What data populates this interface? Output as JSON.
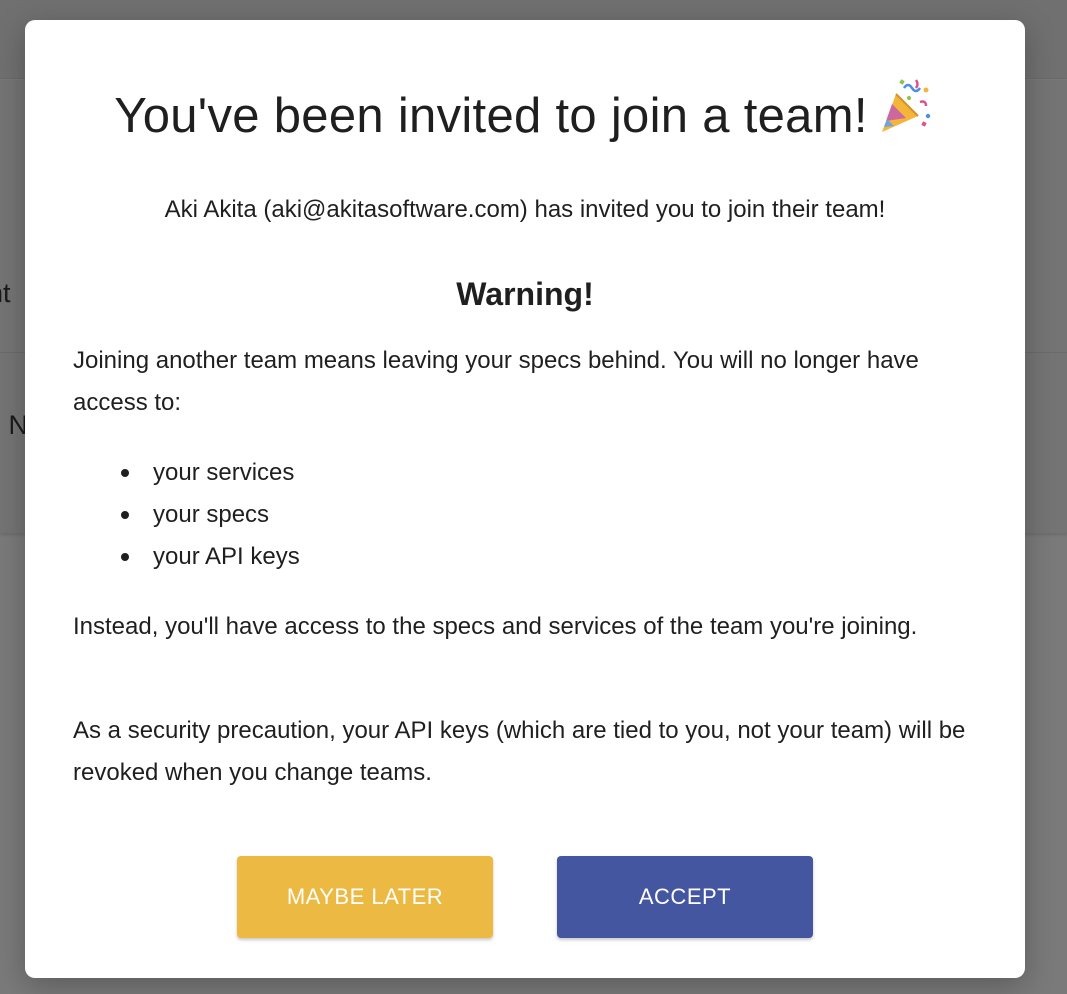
{
  "background": {
    "partial_text_1": "nt",
    "partial_text_2": "d N"
  },
  "modal": {
    "title": "You've been invited to join a team!",
    "title_icon": "party-popper-icon",
    "invite_text": "Aki Akita (aki@akitasoftware.com) has invited you to join their team!",
    "warning_heading": "Warning!",
    "paragraph_1": "Joining another team means leaving your specs behind. You will no longer have access to:",
    "list_items": [
      "your services",
      "your specs",
      "your API keys"
    ],
    "paragraph_2": "Instead, you'll have access to the specs and services of the team you're joining.",
    "paragraph_3": "As a security precaution, your API keys (which are tied to you, not your team) will be revoked when you change teams.",
    "buttons": {
      "maybe_later": "MAYBE LATER",
      "accept": "ACCEPT"
    }
  },
  "colors": {
    "maybe_later_bg": "#ecb942",
    "accept_bg": "#4456a0",
    "overlay": "#6e6e6e"
  }
}
